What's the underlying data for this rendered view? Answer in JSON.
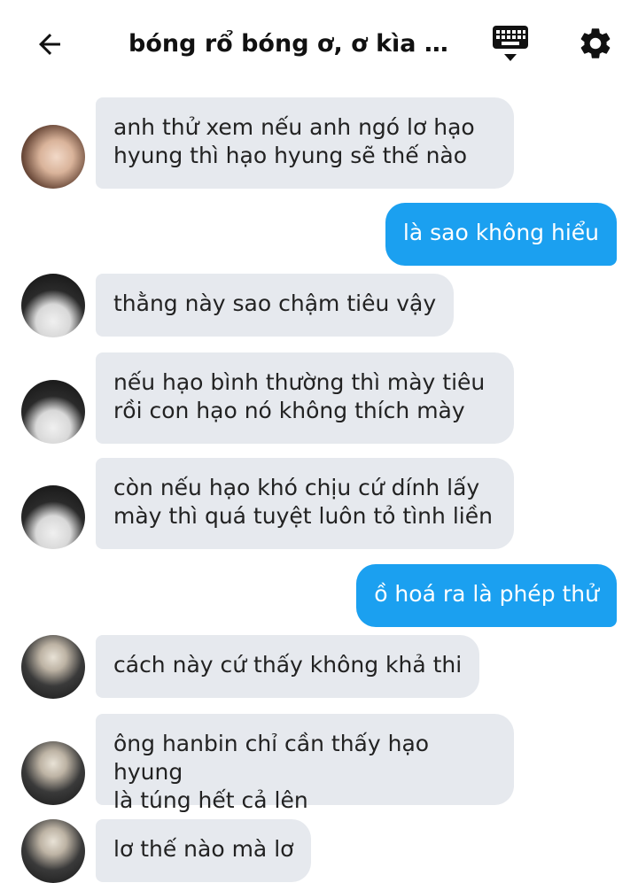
{
  "header": {
    "title": "bóng rổ bóng ơ, ơ kìa bóng ơ",
    "back_icon": "arrow-left-icon",
    "keyboard_icon": "keyboard-icon",
    "settings_icon": "gear-icon"
  },
  "messages": [
    {
      "from": "other",
      "avatar": "avatar-a",
      "text": "anh thử xem nếu anh ngó lơ hạo\nhyung thì hạo hyung sẽ thế nào"
    },
    {
      "from": "me",
      "text": "là sao không hiểu"
    },
    {
      "from": "other",
      "avatar": "avatar-b",
      "text": "thằng này sao chậm tiêu vậy"
    },
    {
      "from": "other",
      "avatar": "avatar-b",
      "text": "nếu hạo bình thường thì mày tiêu\nrồi con hạo nó không thích mày"
    },
    {
      "from": "other",
      "avatar": "avatar-b",
      "text": "còn nếu hạo khó chịu cứ dính lấy\nmày thì quá tuyệt luôn tỏ tình liền"
    },
    {
      "from": "me",
      "text": "ồ hoá ra là phép thử"
    },
    {
      "from": "other",
      "avatar": "avatar-c",
      "text": "cách này cứ thấy không khả thi"
    },
    {
      "from": "other",
      "avatar": "avatar-c",
      "text": "ông hanbin chỉ cần thấy hạo hyung\nlà túng hết cả lên"
    },
    {
      "from": "other",
      "avatar": "avatar-c",
      "text": "lơ thế nào mà lơ"
    }
  ],
  "colors": {
    "sent_bubble": "#1ba0f0",
    "received_bubble": "#e6e9ee"
  }
}
